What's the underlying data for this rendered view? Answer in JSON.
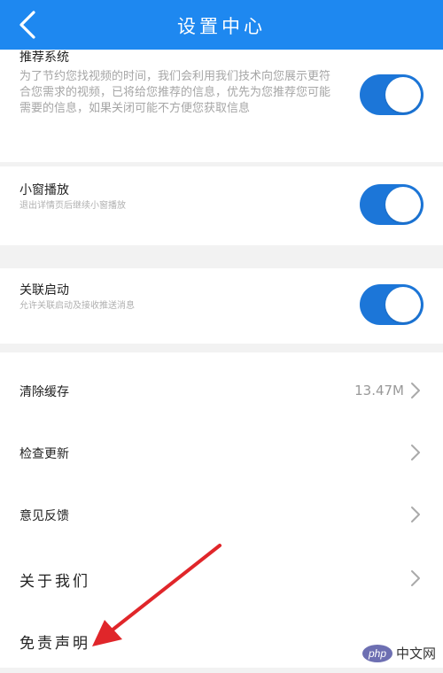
{
  "header": {
    "title": "设置中心",
    "back_icon": "back-arrow-icon"
  },
  "recommend": {
    "title": "推荐系统",
    "description": "为了节约您找视频的时间，我们会利用我们技术向您展示更符合您需求的视频，已将给您推荐的信息，优先为您推荐您可能需要的信息，如果关闭可能不方便您获取信息",
    "enabled": true
  },
  "mini_window": {
    "title": "小窗播放",
    "description": "退出详情页后继续小窗播放",
    "enabled": true
  },
  "linked_start": {
    "title": "关联启动",
    "description": "允许关联启动及接收推送消息",
    "enabled": true
  },
  "list": {
    "clear_cache": {
      "label": "清除缓存",
      "value": "13.47M"
    },
    "check_update": {
      "label": "检查更新"
    },
    "feedback": {
      "label": "意见反馈"
    },
    "about": {
      "label": "关于我们"
    },
    "disclaimer": {
      "label": "免责声明"
    }
  },
  "watermark": {
    "badge": "php",
    "text": "中文网"
  },
  "colors": {
    "header": "#1e88f0",
    "toggle": "#1c76d8",
    "arrow": "#e0262a"
  }
}
